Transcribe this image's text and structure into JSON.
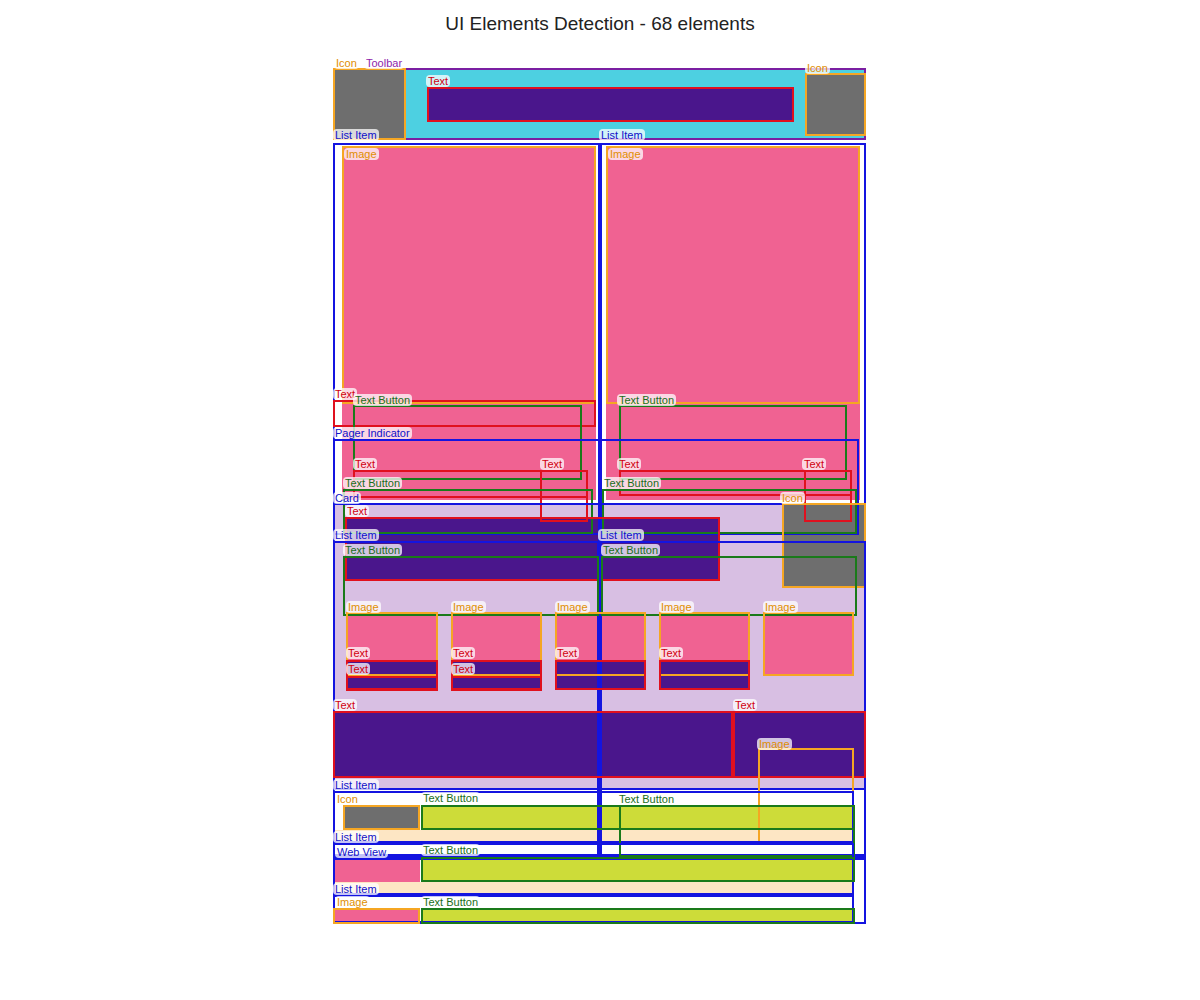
{
  "title": "UI Elements Detection - 68 elements",
  "elements": [
    {
      "label": "Toolbar",
      "kind": "toolbar"
    },
    {
      "label": "Icon",
      "kind": "icon"
    },
    {
      "label": "Text",
      "kind": "text"
    },
    {
      "label": "Icon",
      "kind": "icon"
    },
    {
      "label": "List Item",
      "kind": "list"
    },
    {
      "label": "Image",
      "kind": "image"
    },
    {
      "label": "List Item",
      "kind": "list"
    },
    {
      "label": "Image",
      "kind": "image"
    },
    {
      "label": "Text",
      "kind": "text"
    },
    {
      "label": "Text Button",
      "kind": "button"
    },
    {
      "label": "Text Button",
      "kind": "button"
    },
    {
      "label": "Pager Indicator",
      "kind": "container"
    },
    {
      "label": "Text",
      "kind": "text"
    },
    {
      "label": "Text",
      "kind": "text"
    },
    {
      "label": "Text",
      "kind": "text"
    },
    {
      "label": "Text",
      "kind": "text"
    },
    {
      "label": "Text Button",
      "kind": "button"
    },
    {
      "label": "Text Button",
      "kind": "button"
    },
    {
      "label": "Card",
      "kind": "container"
    },
    {
      "label": "Icon",
      "kind": "icon"
    },
    {
      "label": "Text",
      "kind": "text"
    },
    {
      "label": "List Item",
      "kind": "list"
    },
    {
      "label": "List Item",
      "kind": "list"
    },
    {
      "label": "Text Button",
      "kind": "button"
    },
    {
      "label": "Text Button",
      "kind": "button"
    },
    {
      "label": "Image",
      "kind": "image"
    },
    {
      "label": "Image",
      "kind": "image"
    },
    {
      "label": "Image",
      "kind": "image"
    },
    {
      "label": "Image",
      "kind": "image"
    },
    {
      "label": "Image",
      "kind": "image"
    },
    {
      "label": "Text",
      "kind": "text"
    },
    {
      "label": "Text",
      "kind": "text"
    },
    {
      "label": "Text",
      "kind": "text"
    },
    {
      "label": "Text",
      "kind": "text"
    },
    {
      "label": "Text",
      "kind": "text"
    },
    {
      "label": "Text",
      "kind": "text"
    },
    {
      "label": "Text",
      "kind": "text"
    },
    {
      "label": "Text",
      "kind": "text"
    },
    {
      "label": "Image",
      "kind": "image"
    },
    {
      "label": "List Item",
      "kind": "list"
    },
    {
      "label": "Icon",
      "kind": "icon"
    },
    {
      "label": "Text Button",
      "kind": "button"
    },
    {
      "label": "Text Button",
      "kind": "button"
    },
    {
      "label": "List Item",
      "kind": "list"
    },
    {
      "label": "Web View",
      "kind": "container"
    },
    {
      "label": "Text Button",
      "kind": "button"
    },
    {
      "label": "List Item",
      "kind": "list"
    },
    {
      "label": "Image",
      "kind": "image"
    },
    {
      "label": "Text Button",
      "kind": "button"
    }
  ]
}
